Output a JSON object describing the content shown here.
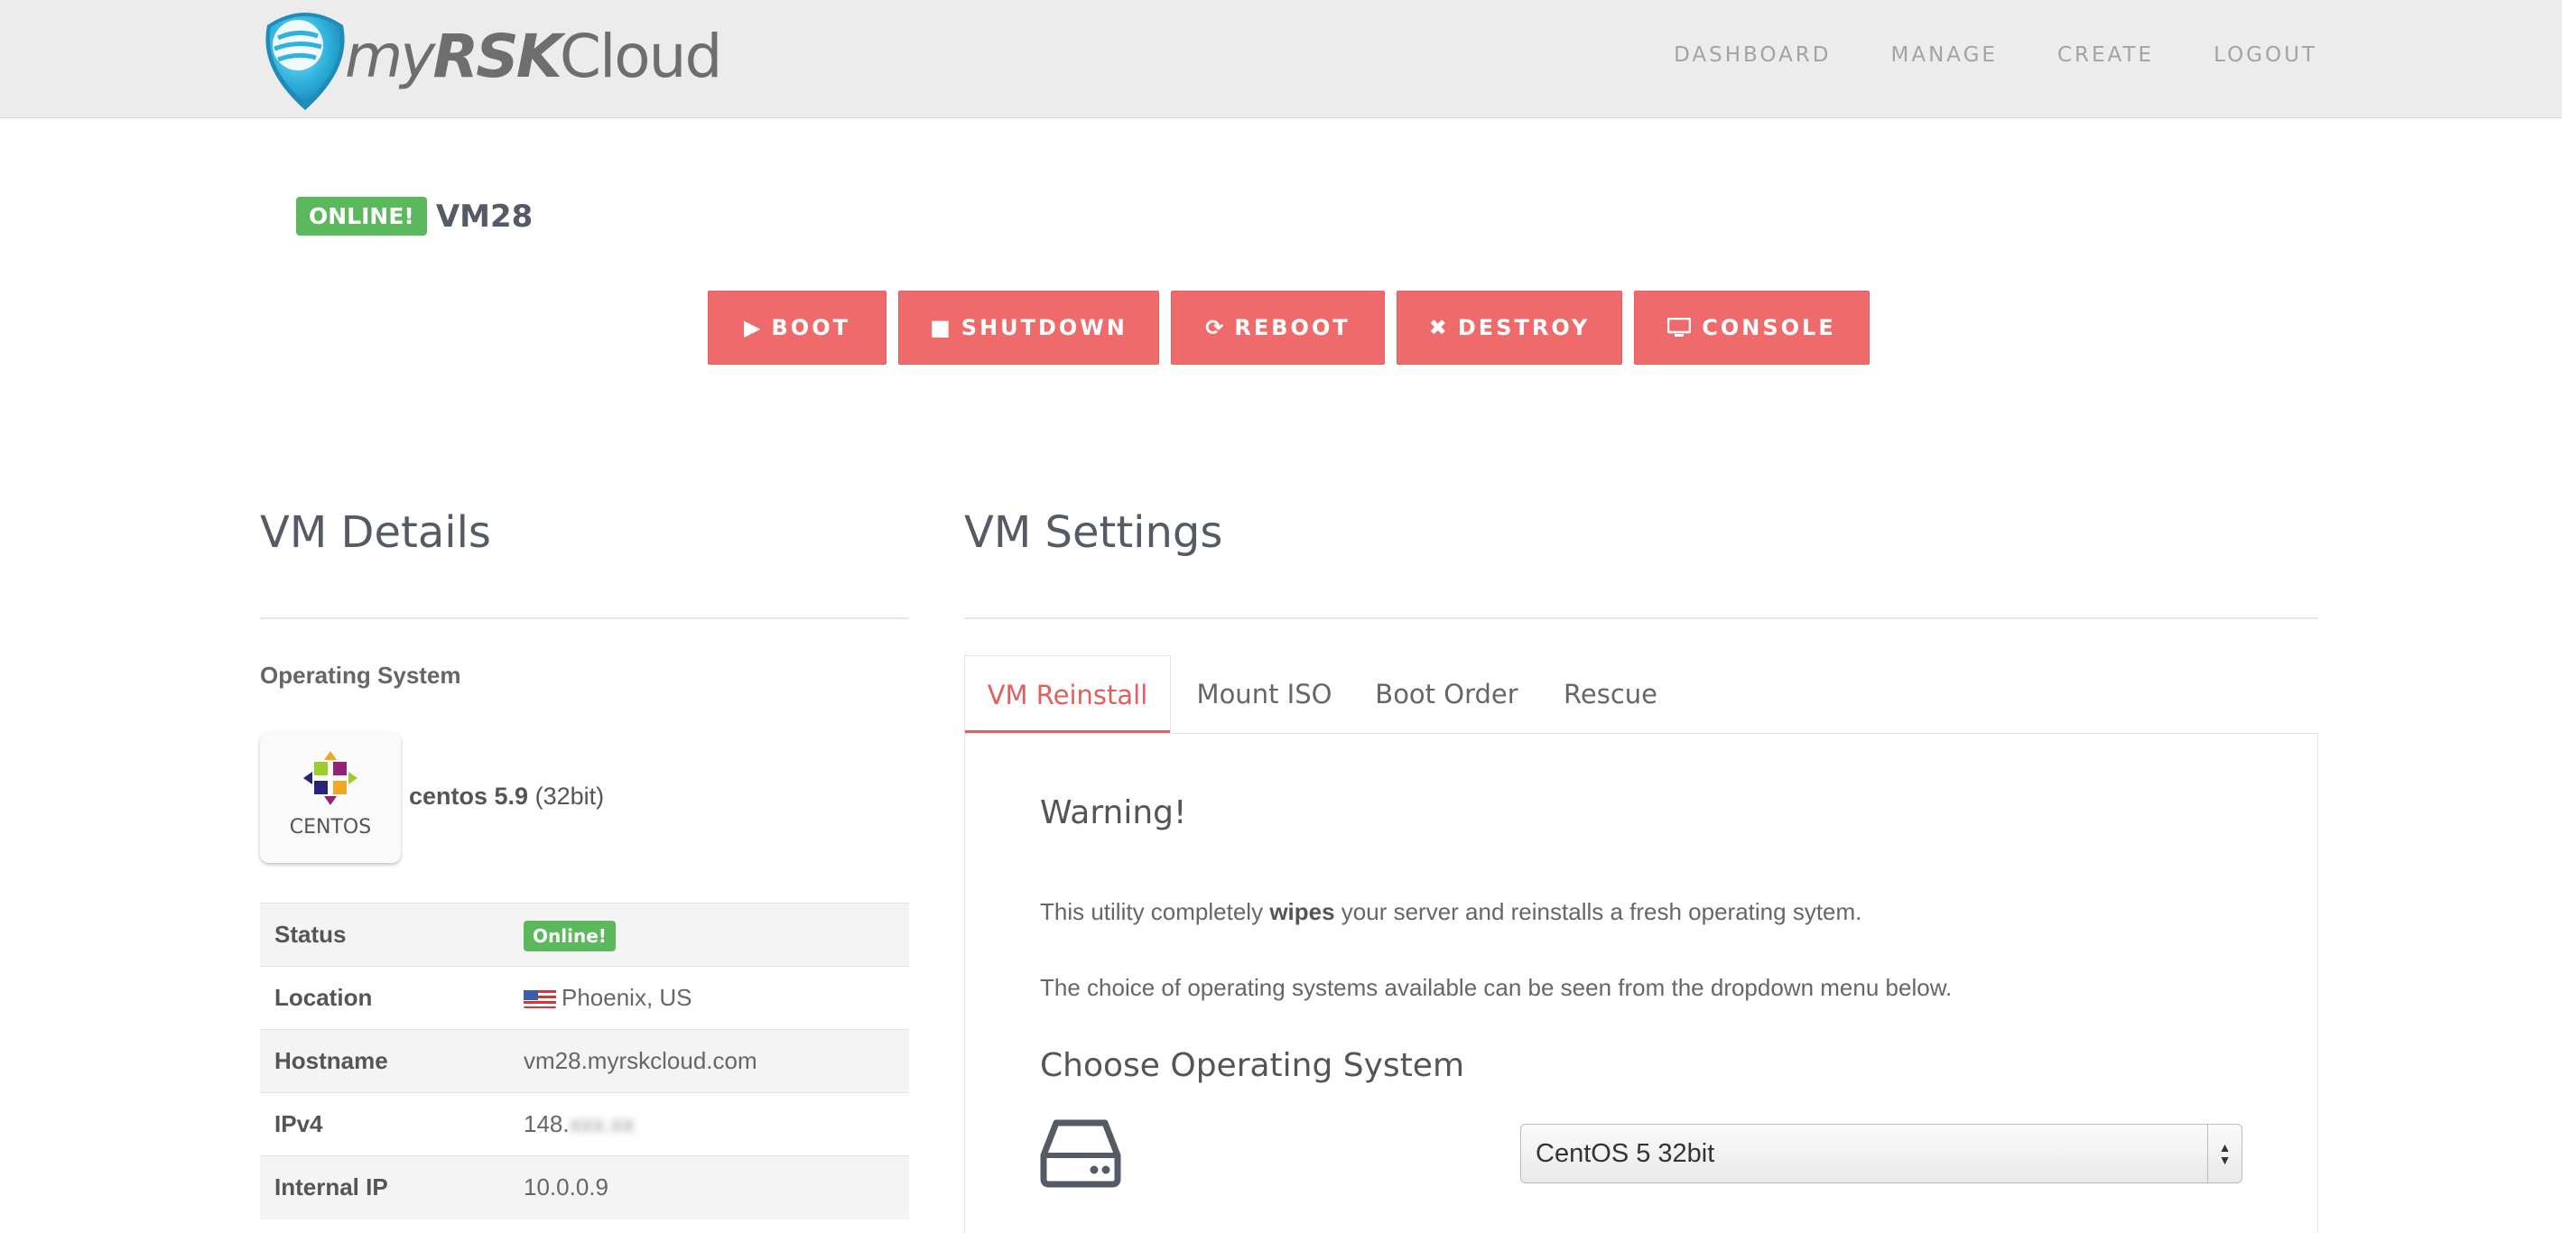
{
  "header": {
    "logo_prefix": "my",
    "logo_brand": "RSK",
    "logo_suffix": "Cloud",
    "nav": [
      "DASHBOARD",
      "MANAGE",
      "CREATE",
      "LOGOUT"
    ]
  },
  "vm": {
    "status_badge": "ONLINE!",
    "name": "VM28"
  },
  "actions": {
    "boot": "BOOT",
    "shutdown": "SHUTDOWN",
    "reboot": "REBOOT",
    "destroy": "DESTROY",
    "console": "CONSOLE"
  },
  "details": {
    "title": "VM Details",
    "os_label": "Operating System",
    "os_logo_word": "CENTOS",
    "os_name": "centos 5.9",
    "os_arch": "(32bit)",
    "rows": [
      {
        "key": "Status",
        "value": "Online!"
      },
      {
        "key": "Location",
        "value": "Phoenix, US"
      },
      {
        "key": "Hostname",
        "value": "vm28.myrskcloud.com"
      },
      {
        "key": "IPv4",
        "value": "148.",
        "blurred_part": "xxx.xx"
      },
      {
        "key": "Internal IP",
        "value": "10.0.0.9"
      }
    ]
  },
  "settings": {
    "title": "VM Settings",
    "tabs": [
      "VM Reinstall",
      "Mount ISO",
      "Boot Order",
      "Rescue"
    ],
    "active_tab": "VM Reinstall",
    "warning_title": "Warning!",
    "para1_before": "This utility completely ",
    "para1_bold": "wipes",
    "para1_after": " your server and reinstalls a fresh operating sytem.",
    "para2": "The choice of operating systems available can be seen from the dropdown menu below.",
    "choose_title": "Choose Operating System",
    "selected_os": "CentOS 5 32bit"
  },
  "colors": {
    "accent_red": "#ef6a6a",
    "online_green": "#5cb85c",
    "header_bg": "#ececec"
  }
}
